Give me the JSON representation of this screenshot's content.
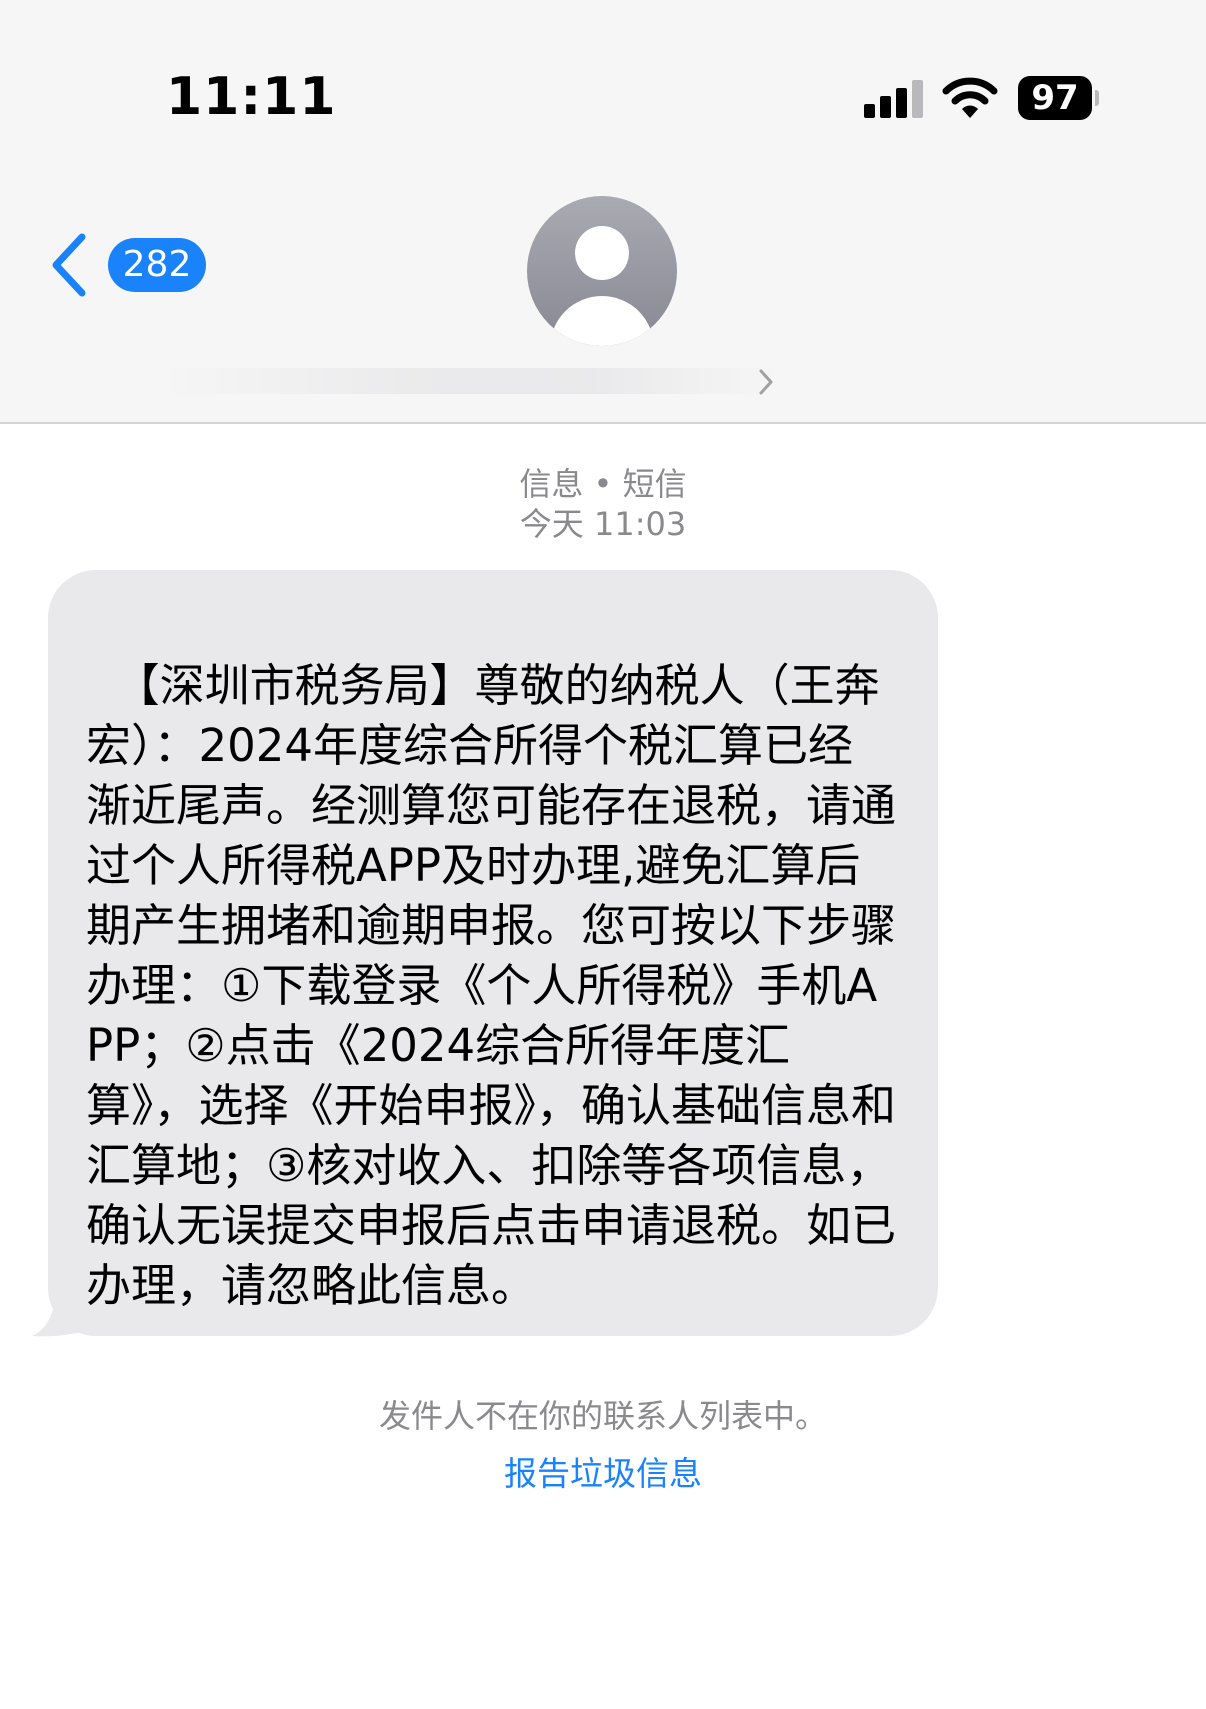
{
  "status_bar": {
    "time": "11:11",
    "battery": "97"
  },
  "nav": {
    "back_count": "282"
  },
  "thread": {
    "service_label": "信息 • 短信",
    "timestamp": "今天 11:03"
  },
  "message": {
    "text": "【深圳市税务局】尊敬的纳税人（王奔宏）：2024年度综合所得个税汇算已经渐近尾声。经测算您可能存在退税，请通过个人所得税APP及时办理,避免汇算后期产生拥堵和逾期申报。您可按以下步骤办理：①下载登录《个人所得税》手机APP；②点击《2024综合所得年度汇算》，选择《开始申报》，确认基础信息和汇算地；③核对收入、扣除等各项信息，确认无误提交申报后点击申请退税。如已办理，请忽略此信息。"
  },
  "footer": {
    "unknown_sender_notice": "发件人不在你的联系人列表中。",
    "report_junk_label": "报告垃圾信息"
  },
  "colors": {
    "accent": "#1a82fb",
    "bubble": "#e9e9eb",
    "header_bg": "#f6f6f6",
    "meta_text": "#8a8a8e"
  },
  "icons": {
    "signal": "cellular-signal-icon",
    "wifi": "wifi-icon",
    "battery": "battery-icon",
    "back": "chevron-left-icon",
    "avatar": "person-placeholder-icon",
    "contact_details": "chevron-right-icon"
  }
}
